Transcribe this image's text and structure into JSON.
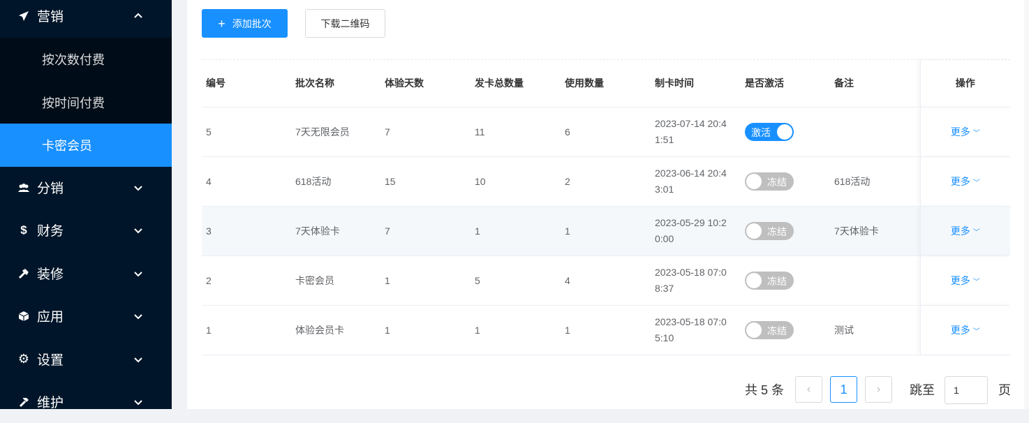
{
  "sidebar": {
    "menus": [
      {
        "label": "营销",
        "icon": "send-icon",
        "expanded": true
      },
      {
        "label": "分销",
        "icon": "users-icon"
      },
      {
        "label": "财务",
        "icon": "dollar-icon"
      },
      {
        "label": "装修",
        "icon": "tools-icon"
      },
      {
        "label": "应用",
        "icon": "cube-icon"
      },
      {
        "label": "设置",
        "icon": "gear-icon"
      },
      {
        "label": "维护",
        "icon": "hammer-icon"
      }
    ],
    "submenu": [
      {
        "label": "按次数付费"
      },
      {
        "label": "按时间付费"
      },
      {
        "label": "卡密会员",
        "active": true
      }
    ]
  },
  "toolbar": {
    "add_label": "添加批次",
    "download_label": "下载二维码"
  },
  "table": {
    "columns": [
      "编号",
      "批次名称",
      "体验天数",
      "发卡总数量",
      "使用数量",
      "制卡时间",
      "是否激活",
      "备注",
      "操作"
    ],
    "rows": [
      {
        "id": "5",
        "name": "7天无限会员",
        "days": "7",
        "total": "11",
        "used": "6",
        "time_l1": "2023-07-14 20:4",
        "time_l2": "1:51",
        "switch": "激活",
        "active": true,
        "note": "",
        "more": "更多"
      },
      {
        "id": "4",
        "name": "618活动",
        "days": "15",
        "total": "10",
        "used": "2",
        "time_l1": "2023-06-14 20:4",
        "time_l2": "3:01",
        "switch": "冻结",
        "active": false,
        "note": "618活动",
        "more": "更多"
      },
      {
        "id": "3",
        "name": "7天体验卡",
        "days": "7",
        "total": "1",
        "used": "1",
        "time_l1": "2023-05-29 10:2",
        "time_l2": "0:00",
        "switch": "冻结",
        "active": false,
        "note": "7天体验卡",
        "more": "更多"
      },
      {
        "id": "2",
        "name": "卡密会员",
        "days": "1",
        "total": "5",
        "used": "4",
        "time_l1": "2023-05-18 07:0",
        "time_l2": "8:37",
        "switch": "冻结",
        "active": false,
        "note": "",
        "more": "更多"
      },
      {
        "id": "1",
        "name": "体验会员卡",
        "days": "1",
        "total": "1",
        "used": "1",
        "time_l1": "2023-05-18 07:0",
        "time_l2": "5:10",
        "switch": "冻结",
        "active": false,
        "note": "测试",
        "more": "更多"
      }
    ]
  },
  "pagination": {
    "total_text": "共 5 条",
    "current_page": "1",
    "jump_label": "跳至",
    "jump_value": "1",
    "page_suffix": "页"
  },
  "colors": {
    "primary": "#1890ff",
    "sidebar": "#001529"
  }
}
